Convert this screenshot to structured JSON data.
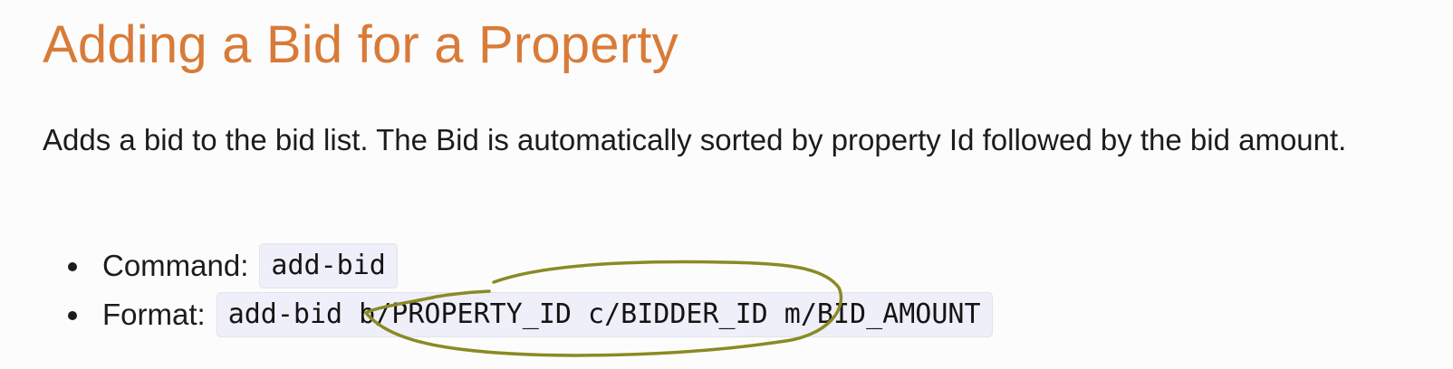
{
  "heading": {
    "title": "Adding a Bid for a Property",
    "color": "#d97b38"
  },
  "description": "Adds a bid to the bid list. The Bid is automatically sorted by property Id followed by the bid amount.",
  "specs": [
    {
      "label": "Command:",
      "code": "add-bid"
    },
    {
      "label": "Format:",
      "code": "add-bid b/PROPERTY_ID c/BIDDER_ID m/BID_AMOUNT"
    }
  ],
  "annotation": {
    "type": "hand-drawn-circle",
    "color": "#8a8a24"
  }
}
